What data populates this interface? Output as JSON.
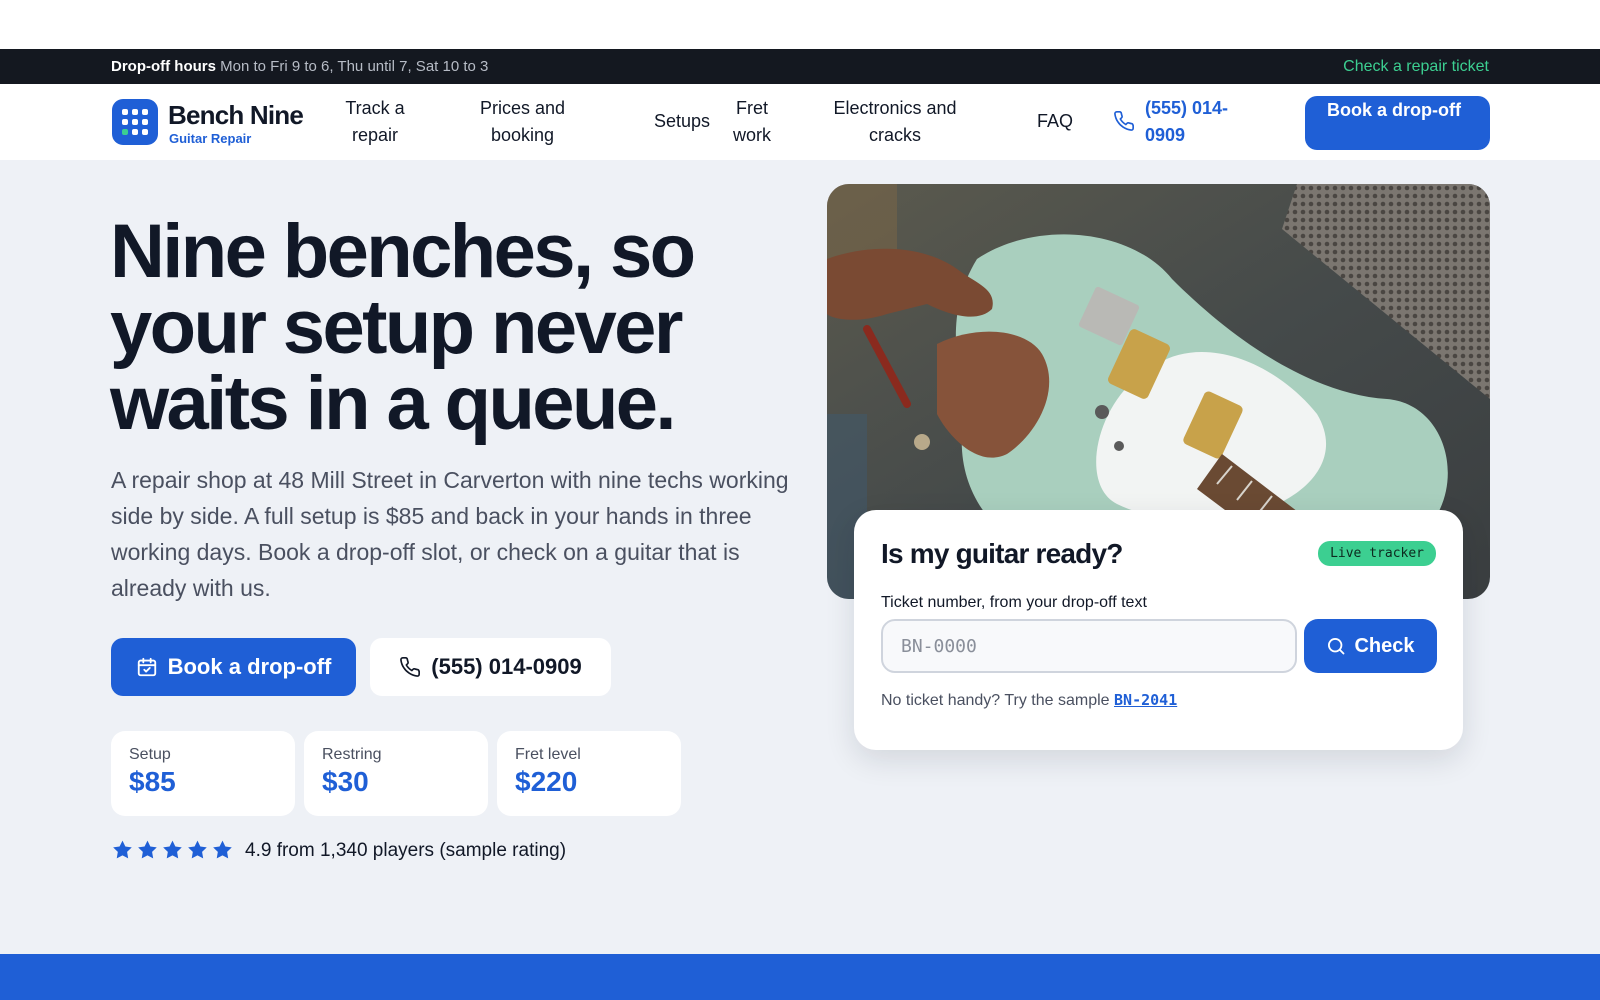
{
  "hours_bar": {
    "label": "Drop-off hours",
    "detail": "Mon to Fri 9 to 6, Thu until 7, Sat 10 to 3",
    "ticket_link": "Check a repair ticket"
  },
  "brand": {
    "name": "Bench Nine",
    "tagline": "Guitar Repair",
    "logo_icon": "grid-logo-icon"
  },
  "nav": {
    "items": [
      {
        "label": "Track a repair"
      },
      {
        "label": "Prices and booking"
      },
      {
        "label": "Setups"
      },
      {
        "label": "Fret work"
      },
      {
        "label": "Electronics and cracks"
      },
      {
        "label": "FAQ"
      }
    ],
    "phone": "(555) 014-0909",
    "phone_icon": "phone-icon",
    "cta": "Book a drop-off"
  },
  "hero": {
    "headline": "Nine benches, so your setup never waits in a queue.",
    "lede": "A repair shop at 48 Mill Street in Carverton with nine techs working side by side. A full setup is $85 and back in your hands in three working days. Book a drop-off slot, or check on a guitar that is already with us.",
    "primary_cta": "Book a drop-off",
    "primary_icon": "calendar-check-icon",
    "secondary_cta": "(555) 014-0909",
    "secondary_icon": "phone-icon",
    "prices": [
      {
        "label": "Setup",
        "value": "$85"
      },
      {
        "label": "Restring",
        "value": "$30"
      },
      {
        "label": "Fret level",
        "value": "$220"
      }
    ],
    "rating": {
      "stars": 5,
      "text": "4.9 from 1,340 players (sample rating)"
    },
    "photo_subject": "guitar-on-workbench-photo"
  },
  "tracker": {
    "title": "Is my guitar ready?",
    "badge": "Live tracker",
    "field_label": "Ticket number, from your drop-off text",
    "placeholder": "BN-0000",
    "check_label": "Check",
    "check_icon": "search-icon",
    "sample_prefix": "No ticket handy? Try the sample",
    "sample_ticket": "BN-2041"
  },
  "colors": {
    "brand_blue": "#1f5fd6",
    "accent_green": "#3ccf91",
    "dark_bar": "#141820",
    "hero_bg": "#eef1f6"
  }
}
